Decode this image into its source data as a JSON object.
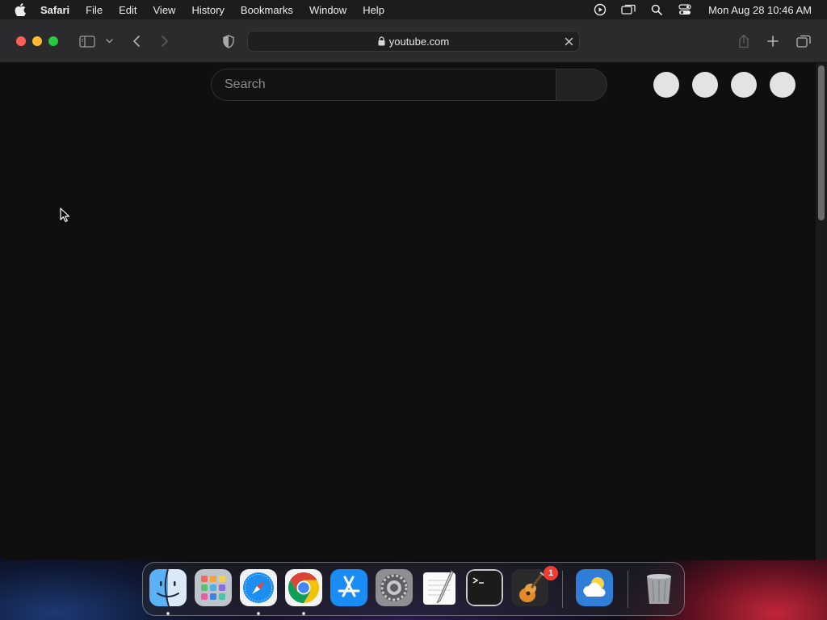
{
  "menubar": {
    "app_name": "Safari",
    "items": [
      "File",
      "Edit",
      "View",
      "History",
      "Bookmarks",
      "Window",
      "Help"
    ],
    "clock": "Mon Aug 28  10:46 AM"
  },
  "browser": {
    "address": "youtube.com"
  },
  "page": {
    "search_placeholder": "Search"
  },
  "dock": {
    "apps": [
      "Finder",
      "Launchpad",
      "Safari",
      "Google Chrome",
      "App Store",
      "System Settings",
      "TextEdit",
      "Terminal",
      "GarageBand",
      "Weather",
      "Trash"
    ],
    "settings_badge": "1"
  },
  "colors": {
    "accent_red": "#ff5f57",
    "accent_yellow": "#febc2e",
    "accent_green": "#28c840",
    "page_bg": "#0f0f0f"
  }
}
